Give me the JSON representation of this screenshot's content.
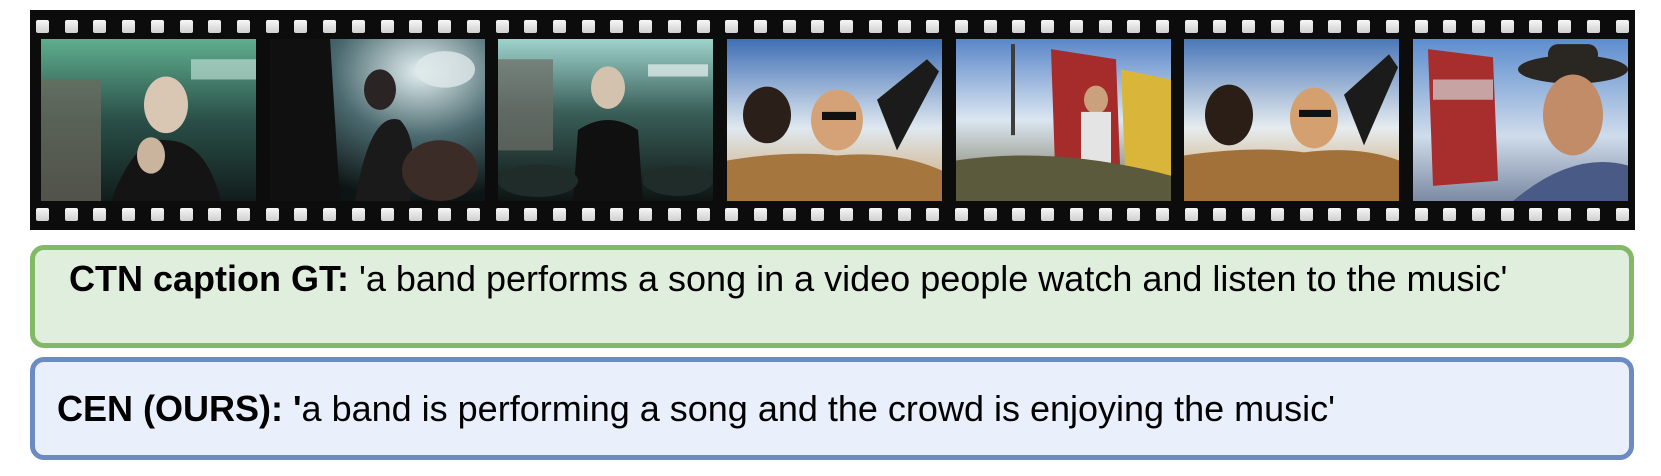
{
  "filmstrip": {
    "frames": [
      {
        "scene": "singer-in-club"
      },
      {
        "scene": "dancers-in-club"
      },
      {
        "scene": "drummer-playing"
      },
      {
        "scene": "riders-in-convertible"
      },
      {
        "scene": "man-at-roadside-sign"
      },
      {
        "scene": "riders-in-convertible"
      },
      {
        "scene": "cowboy-at-sign"
      }
    ],
    "perforations_per_row": 56
  },
  "captions": {
    "gt": {
      "label": "CTN caption GT:",
      "text": " 'a band performs a song in a video people watch and listen to the music'"
    },
    "ours": {
      "label": "CEN (OURS): '",
      "text": "a band is performing a song and the crowd is enjoying the music'"
    }
  },
  "colors": {
    "gt_fill": "#e0eedd",
    "gt_border": "#82b866",
    "ours_fill": "#e9effb",
    "ours_border": "#6b8bc2",
    "film": "#0c0c0c"
  }
}
